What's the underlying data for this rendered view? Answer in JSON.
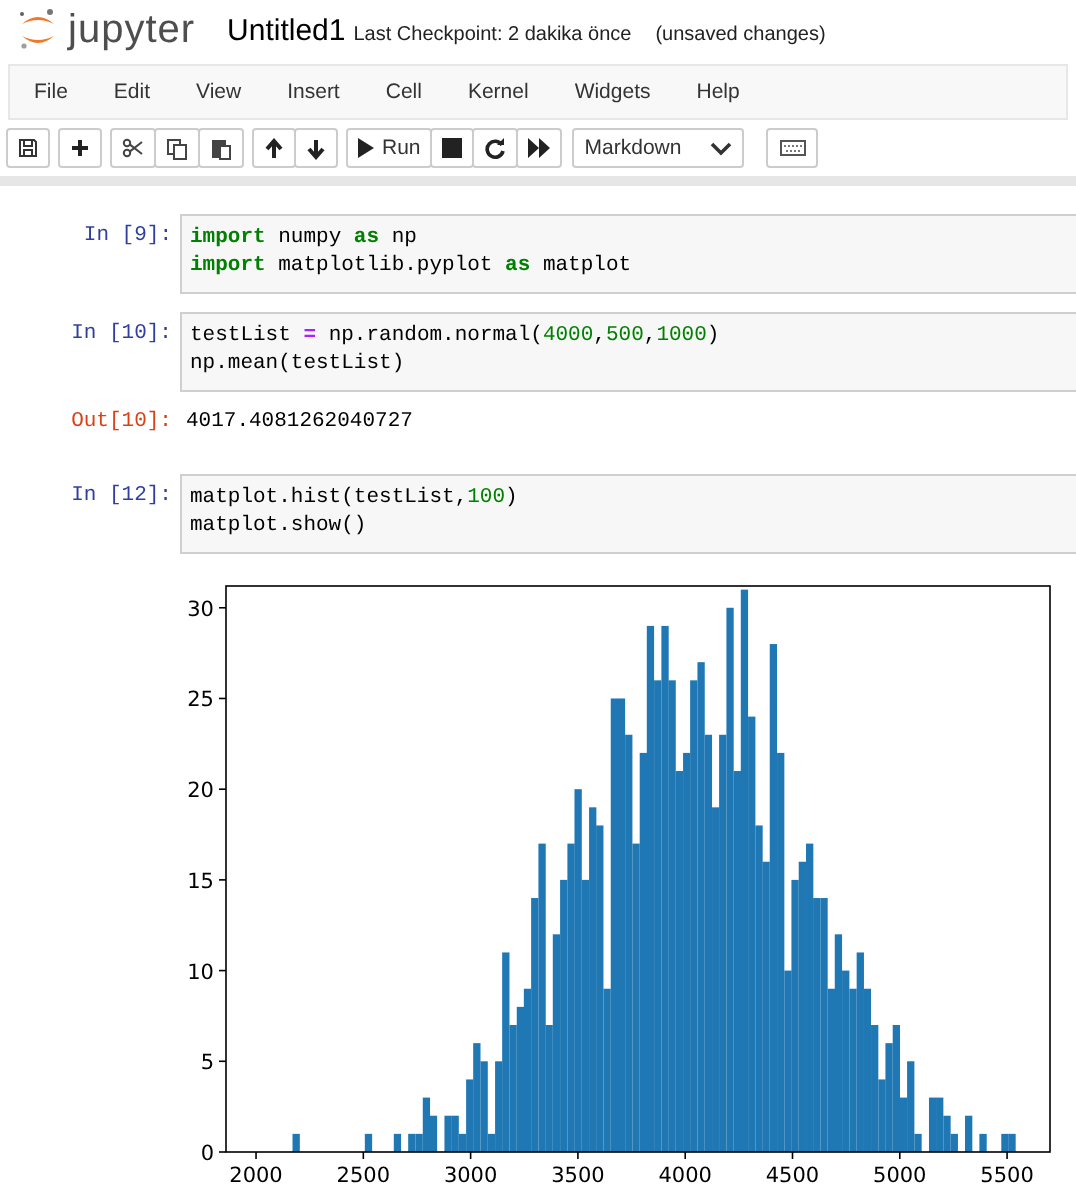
{
  "header": {
    "logo_text": "jupyter",
    "notebook_title": "Untitled1",
    "checkpoint": "Last Checkpoint: 2 dakika önce",
    "save_status": "(unsaved changes)"
  },
  "menu": [
    "File",
    "Edit",
    "View",
    "Insert",
    "Cell",
    "Kernel",
    "Widgets",
    "Help"
  ],
  "toolbar": {
    "run_label": "Run",
    "cell_type": "Markdown"
  },
  "cells": [
    {
      "kind": "input",
      "prompt": "In [9]:",
      "lines": [
        [
          {
            "kind": "keyword",
            "text": "import"
          },
          {
            "kind": "plain",
            "text": " numpy "
          },
          {
            "kind": "keyword",
            "text": "as"
          },
          {
            "kind": "plain",
            "text": " np"
          }
        ],
        [
          {
            "kind": "keyword",
            "text": "import"
          },
          {
            "kind": "plain",
            "text": " matplotlib.pyplot "
          },
          {
            "kind": "keyword",
            "text": "as"
          },
          {
            "kind": "plain",
            "text": " matplot"
          }
        ]
      ]
    },
    {
      "kind": "input",
      "prompt": "In [10]:",
      "lines": [
        [
          {
            "kind": "plain",
            "text": "testList "
          },
          {
            "kind": "operator",
            "text": "="
          },
          {
            "kind": "plain",
            "text": " np.random.normal("
          },
          {
            "kind": "number",
            "text": "4000"
          },
          {
            "kind": "plain",
            "text": ","
          },
          {
            "kind": "number",
            "text": "500"
          },
          {
            "kind": "plain",
            "text": ","
          },
          {
            "kind": "number",
            "text": "1000"
          },
          {
            "kind": "plain",
            "text": ")"
          }
        ],
        [
          {
            "kind": "plain",
            "text": "np.mean(testList)"
          }
        ]
      ]
    },
    {
      "kind": "output",
      "prompt": "Out[10]:",
      "text": "4017.4081262040727"
    },
    {
      "kind": "input",
      "prompt": "In [12]:",
      "lines": [
        [
          {
            "kind": "plain",
            "text": "matplot.hist(testList,"
          },
          {
            "kind": "number",
            "text": "100"
          },
          {
            "kind": "plain",
            "text": ")"
          }
        ],
        [
          {
            "kind": "plain",
            "text": "matplot.show()"
          }
        ]
      ]
    }
  ],
  "chart_data": {
    "type": "bar",
    "x": [
      2170,
      2204,
      2237,
      2271,
      2305,
      2338,
      2372,
      2406,
      2440,
      2473,
      2507,
      2541,
      2574,
      2608,
      2642,
      2675,
      2709,
      2743,
      2777,
      2810,
      2844,
      2878,
      2911,
      2945,
      2979,
      3012,
      3046,
      3080,
      3114,
      3147,
      3181,
      3215,
      3248,
      3282,
      3316,
      3349,
      3383,
      3417,
      3451,
      3484,
      3518,
      3552,
      3585,
      3619,
      3653,
      3686,
      3720,
      3754,
      3788,
      3821,
      3855,
      3889,
      3922,
      3956,
      3990,
      4023,
      4057,
      4091,
      4125,
      4158,
      4192,
      4226,
      4259,
      4293,
      4327,
      4360,
      4394,
      4428,
      4462,
      4495,
      4529,
      4563,
      4596,
      4630,
      4664,
      4697,
      4731,
      4765,
      4799,
      4832,
      4866,
      4900,
      4933,
      4967,
      5001,
      5034,
      5068,
      5102,
      5136,
      5169,
      5203,
      5237,
      5270,
      5304,
      5338,
      5371,
      5405,
      5439,
      5473,
      5506
    ],
    "series": [
      {
        "color": "#1f77b4",
        "values": [
          1,
          0,
          0,
          0,
          0,
          0,
          0,
          0,
          0,
          0,
          1,
          0,
          0,
          0,
          1,
          0,
          1,
          1,
          3,
          2,
          0,
          2,
          2,
          1,
          4,
          6,
          5,
          1,
          5,
          11,
          7,
          8,
          9,
          14,
          17,
          7,
          12,
          15,
          17,
          20,
          15,
          19,
          18,
          9,
          25,
          25,
          23,
          17,
          22,
          29,
          26,
          29,
          26,
          21,
          22,
          26,
          27,
          23,
          19,
          23,
          30,
          21,
          31,
          24,
          18,
          16,
          28,
          22,
          10,
          15,
          16,
          17,
          14,
          14,
          9,
          12,
          10,
          9,
          11,
          9,
          7,
          4,
          6,
          7,
          3,
          5,
          1,
          0,
          3,
          3,
          2,
          1,
          0,
          2,
          0,
          1,
          0,
          0,
          1,
          1
        ]
      }
    ],
    "xlim": [
      1860,
      5700
    ],
    "ylim": [
      0,
      31.2
    ],
    "xticks": [
      2000,
      2500,
      3000,
      3500,
      4000,
      4500,
      5000,
      5500
    ],
    "yticks": [
      0,
      5,
      10,
      15,
      20,
      25,
      30
    ]
  }
}
